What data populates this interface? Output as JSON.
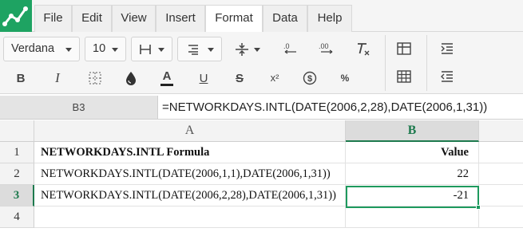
{
  "menu": {
    "items": [
      "File",
      "Edit",
      "View",
      "Insert",
      "Format",
      "Data",
      "Help"
    ],
    "active": "Format"
  },
  "toolbar": {
    "font_family": "Verdana",
    "font_size": "10",
    "icons": [
      "borders-icon",
      "align-icon",
      "valign-icon",
      "decrease-decimals-icon",
      "increase-decimals-icon",
      "clear-format-icon",
      "bold-icon",
      "italic-icon",
      "gridlines-icon",
      "fill-color-icon",
      "text-color-icon",
      "underline-icon",
      "strikethrough-icon",
      "superscript-icon",
      "currency-icon",
      "percent-icon",
      "freeze-icon",
      "table-icon",
      "indent-icon",
      "outdent-icon"
    ],
    "bold": "B",
    "italic": "I",
    "text_color": "A",
    "underline": "U",
    "strike": "S",
    "superscript": "x²",
    "percent": "%"
  },
  "formula_bar": {
    "cell_ref": "B3",
    "formula": "=NETWORKDAYS.INTL(DATE(2006,2,28),DATE(2006,1,31))"
  },
  "sheet": {
    "columns": [
      "A",
      "B"
    ],
    "selected_column": "B",
    "rows": [
      {
        "num": "1",
        "a": "NETWORKDAYS.INTL Formula",
        "b": "Value"
      },
      {
        "num": "2",
        "a": "NETWORKDAYS.INTL(DATE(2006,1,1),DATE(2006,1,31))",
        "b": "22"
      },
      {
        "num": "3",
        "a": "NETWORKDAYS.INTL(DATE(2006,2,28),DATE(2006,1,31))",
        "b": "-21"
      },
      {
        "num": "4",
        "a": "",
        "b": ""
      }
    ],
    "selected_row": "3",
    "accent_color": "#1e9a5e"
  }
}
